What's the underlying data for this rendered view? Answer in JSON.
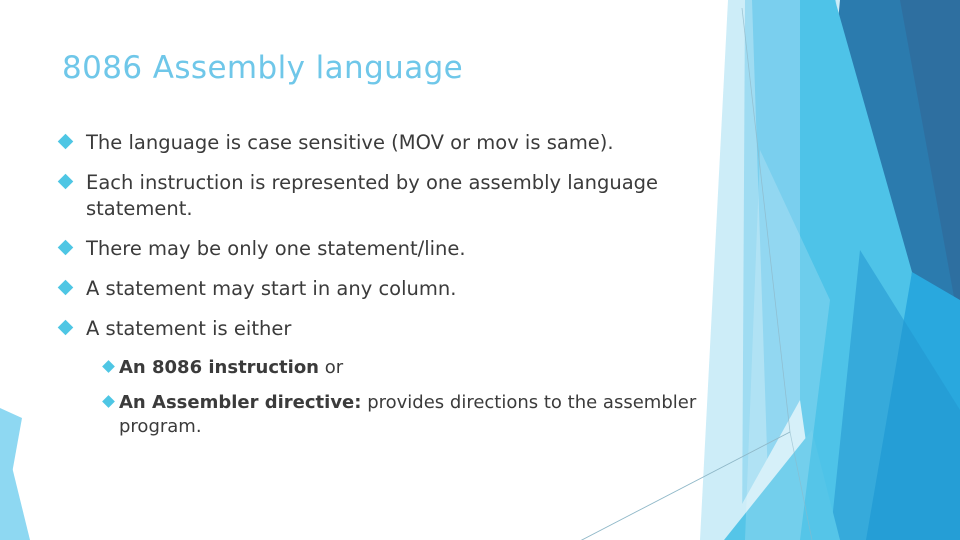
{
  "slide": {
    "title": "8086 Assembly language",
    "background_color": "#FFFFFF",
    "title_color": "#6FC7E9",
    "body_text_color": "#3B3B3B",
    "bullet_color": "#4EC6E4"
  },
  "bullets": [
    {
      "level": 1,
      "bullet_icon": "diamond-bullet-icon",
      "text": "The language is  case sensitive (MOV or mov is same)."
    },
    {
      "level": 1,
      "bullet_icon": "diamond-bullet-icon",
      "text": "Each instruction is represented by one assembly language statement."
    },
    {
      "level": 1,
      "bullet_icon": "diamond-bullet-icon",
      "text": "There may be only one statement/line."
    },
    {
      "level": 1,
      "bullet_icon": "diamond-bullet-icon",
      "text": "A statement may start in any column."
    },
    {
      "level": 1,
      "bullet_icon": "diamond-bullet-icon",
      "text": "A statement is either"
    },
    {
      "level": 2,
      "bullet_icon": "diamond-bullet-icon",
      "bold_text": "An 8086 instruction",
      "text": "  or"
    },
    {
      "level": 2,
      "bullet_icon": "diamond-bullet-icon",
      "bold_text": "An Assembler directive:",
      "text": " provides directions to the assembler program."
    }
  ],
  "decoration": {
    "name": "facet-polygon-artwork",
    "palette": {
      "pale_blue": "#CDEDF8",
      "light_blue": "#9FDCF2",
      "sky_blue": "#7ACFEE",
      "cyan": "#4EC3E8",
      "azure": "#29A8DE",
      "steel_blue": "#2B7BAE",
      "deep_blue": "#2E6FA0",
      "dark_blue": "#24628F",
      "hairline": "#8FB8C8"
    }
  }
}
